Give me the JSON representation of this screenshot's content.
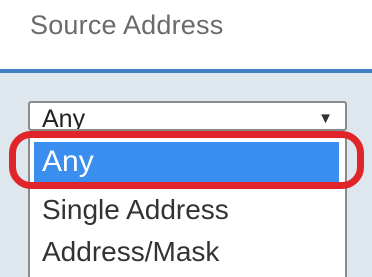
{
  "field": {
    "label": "Source Address",
    "selected_value": "Any",
    "arrow_icon": "caret-down-icon"
  },
  "dropdown": {
    "options": [
      {
        "label": "Any",
        "selected": true
      },
      {
        "label": "Single Address",
        "selected": false
      },
      {
        "label": "Address/Mask",
        "selected": false
      }
    ]
  },
  "colors": {
    "label_text": "#6b6b6b",
    "panel_background": "#dfe7ee",
    "panel_accent": "#3f7fc4",
    "selected_option": "#3a8ef0",
    "annotation_ring": "#e0242a"
  }
}
